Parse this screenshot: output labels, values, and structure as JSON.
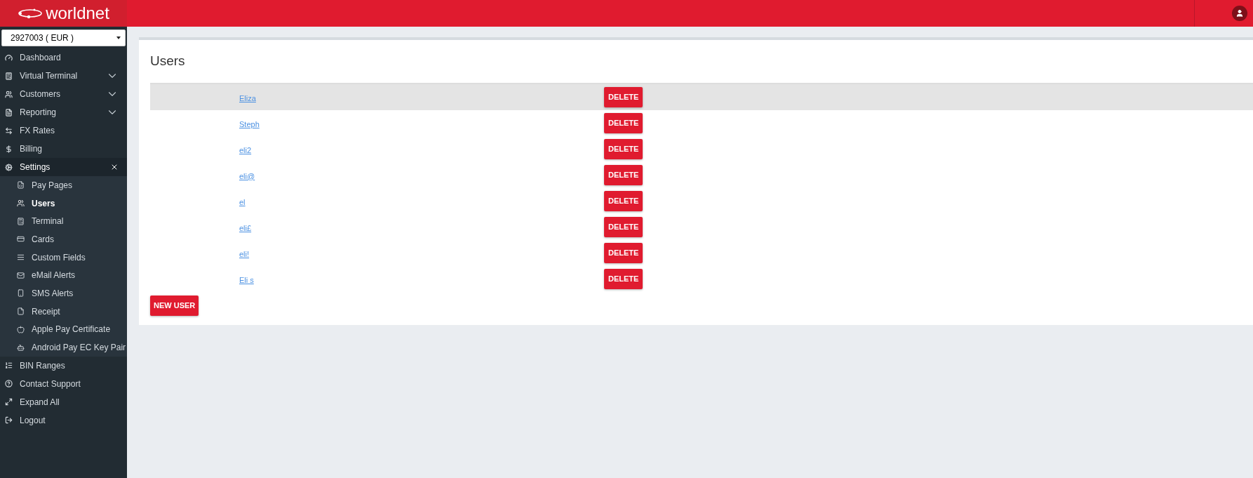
{
  "header": {
    "logo": "worldnet"
  },
  "account_select": {
    "value": "2927003 ( EUR )"
  },
  "nav": [
    {
      "label": "Dashboard"
    },
    {
      "label": "Virtual Terminal",
      "expanded": false
    },
    {
      "label": "Customers",
      "expanded": false
    },
    {
      "label": "Reporting",
      "expanded": false
    },
    {
      "label": "FX Rates"
    },
    {
      "label": "Billing"
    },
    {
      "label": "Settings",
      "expanded": true,
      "children": [
        {
          "label": "Pay Pages",
          "selected": false
        },
        {
          "label": "Users",
          "selected": true
        },
        {
          "label": "Terminal",
          "selected": false
        },
        {
          "label": "Cards",
          "selected": false
        },
        {
          "label": "Custom Fields",
          "selected": false
        },
        {
          "label": "eMail Alerts",
          "selected": false
        },
        {
          "label": "SMS Alerts",
          "selected": false
        },
        {
          "label": "Receipt",
          "selected": false
        },
        {
          "label": "Apple Pay Certificate",
          "selected": false
        },
        {
          "label": "Android Pay EC Key Pair",
          "selected": false
        }
      ]
    },
    {
      "label": "BIN Ranges"
    },
    {
      "label": "Contact Support"
    },
    {
      "label": "Expand All"
    },
    {
      "label": "Logout"
    }
  ],
  "page": {
    "title": "Users",
    "rows": [
      {
        "name": "Eliza",
        "highlighted": true,
        "action": "DELETE"
      },
      {
        "name": "Steph",
        "highlighted": false,
        "action": "DELETE"
      },
      {
        "name": "eli2",
        "highlighted": false,
        "action": "DELETE"
      },
      {
        "name": "eli@",
        "highlighted": false,
        "action": "DELETE"
      },
      {
        "name": "el",
        "highlighted": false,
        "action": "DELETE"
      },
      {
        "name": "eli£",
        "highlighted": false,
        "action": "DELETE"
      },
      {
        "name": "eli!",
        "highlighted": false,
        "action": "DELETE"
      },
      {
        "name": "Eli s",
        "highlighted": false,
        "action": "DELETE"
      }
    ],
    "new_button": "NEW USER"
  }
}
